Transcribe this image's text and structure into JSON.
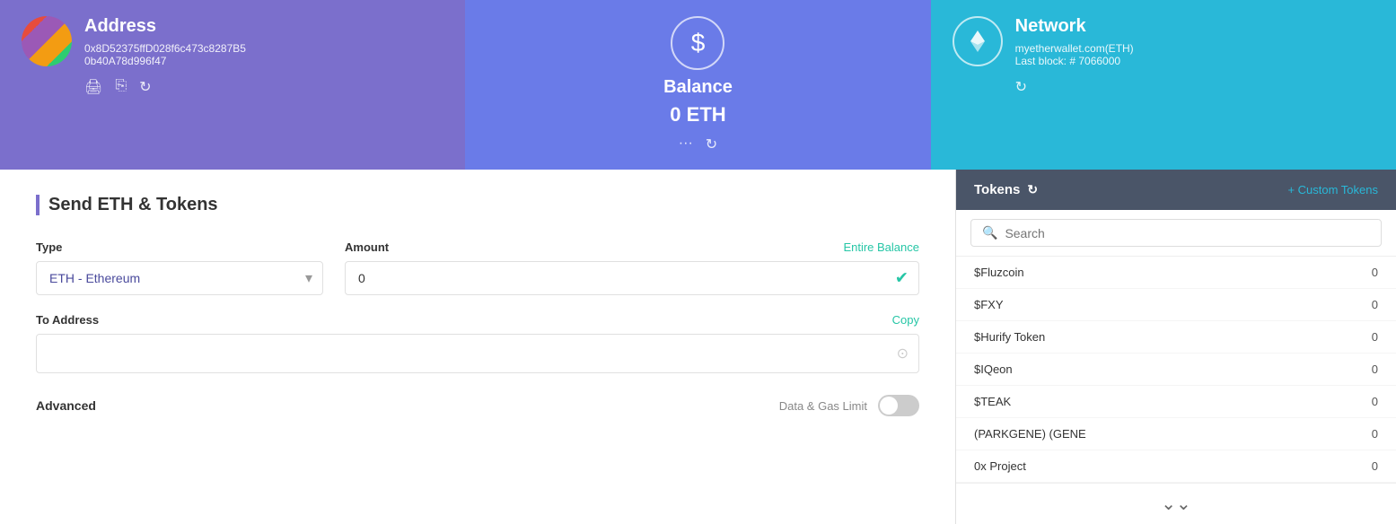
{
  "address_card": {
    "title": "Address",
    "line1": "0x8D52375ffD028f6c473c8287B5",
    "line2": "0b40A78d996f47",
    "icons": [
      "print-icon",
      "copy-icon",
      "refresh-icon"
    ]
  },
  "balance_card": {
    "title": "Balance",
    "amount": "0",
    "currency": "ETH",
    "icons": [
      "more-icon",
      "refresh-icon"
    ]
  },
  "network_card": {
    "title": "Network",
    "name": "myetherwallet.com(ETH)",
    "last_block": "Last block: # 7066000",
    "icons": [
      "refresh-icon"
    ]
  },
  "send_section": {
    "title": "Send ETH & Tokens",
    "type_label": "Type",
    "type_value": "ETH - Ethereum",
    "amount_label": "Amount",
    "amount_value": "0",
    "entire_balance": "Entire Balance",
    "to_address_label": "To Address",
    "copy_label": "Copy",
    "to_address_placeholder": "",
    "advanced_label": "Advanced",
    "gas_limit_label": "Data & Gas Limit"
  },
  "tokens_section": {
    "title": "Tokens",
    "custom_tokens": "+ Custom Tokens",
    "search_placeholder": "Search",
    "tokens": [
      {
        "name": "$Fluzcoin",
        "balance": "0"
      },
      {
        "name": "$FXY",
        "balance": "0"
      },
      {
        "name": "$Hurify Token",
        "balance": "0"
      },
      {
        "name": "$IQeon",
        "balance": "0"
      },
      {
        "name": "$TEAK",
        "balance": "0"
      },
      {
        "name": "(PARKGENE) (GENE",
        "balance": "0"
      },
      {
        "name": "0x Project",
        "balance": "0"
      }
    ]
  }
}
